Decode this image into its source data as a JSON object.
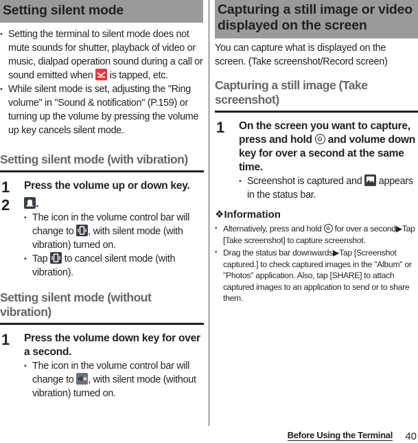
{
  "left": {
    "header": "Setting silent mode",
    "bullets": [
      [
        "Setting the terminal to silent mode does not mute sounds for shutter, playback of video or music, dialpad operation sound during a call or sound emitted when ",
        " is tapped, etc."
      ],
      "While silent mode is set, adjusting the \"Ring volume\" in \"Sound & notification\" (P.159) or turning up the volume by pressing the volume up key cancels silent mode."
    ],
    "sub1": {
      "title": "Setting silent mode (with vibration)",
      "steps": [
        {
          "num": "1",
          "title": "Press the volume up or down key."
        },
        {
          "num": "2",
          "title_suffix": ".",
          "bullets": [
            [
              "The icon in the volume control bar will change to ",
              ", with silent mode (with vibration) turned on."
            ],
            [
              "Tap ",
              " to cancel silent mode (with vibration)."
            ]
          ]
        }
      ]
    },
    "sub2": {
      "title": "Setting silent mode (without vibration)",
      "steps": [
        {
          "num": "1",
          "title": "Press the volume down key for over a second.",
          "bullets": [
            [
              "The icon in the volume control bar will change to ",
              ", with silent mode (without vibration) turned on."
            ]
          ]
        }
      ]
    }
  },
  "right": {
    "header": "Capturing a still image or video displayed on the screen",
    "intro": "You can capture what is displayed on the screen. (Take screenshot/Record screen)",
    "sub1": {
      "title": "Capturing a still image (Take screenshot)",
      "steps": [
        {
          "num": "1",
          "title_parts": [
            "On the screen you want to capture, press and hold ",
            " and volume down key for over a second at the same time."
          ],
          "bullets": [
            [
              "Screenshot is captured and ",
              " appears in the status bar."
            ]
          ]
        }
      ]
    },
    "info": {
      "title": "❖Information",
      "bullets": [
        [
          "Alternatively, press and hold ",
          " for over a second▶Tap [Take screenshot] to capture screenshot."
        ],
        "Drag the status bar downwards▶Tap [Screenshot captured.] to check captured images in the \"Album\" or \"Photos\" application. Also, tap [SHARE] to attach captured images to an application to send or to share them."
      ]
    }
  },
  "footer": {
    "section": "Before Using the Terminal",
    "page": "40"
  },
  "icons": {
    "end_call": "end-call-icon",
    "ringer": "bell-icon",
    "vibrate": "vibrate-icon",
    "mute": "mute-icon",
    "power": "power-icon",
    "screenshot": "screenshot-icon"
  },
  "colors": {
    "band": "#9a9a9a",
    "subheading": "#666666",
    "end_call_icon": "#e8383d"
  }
}
